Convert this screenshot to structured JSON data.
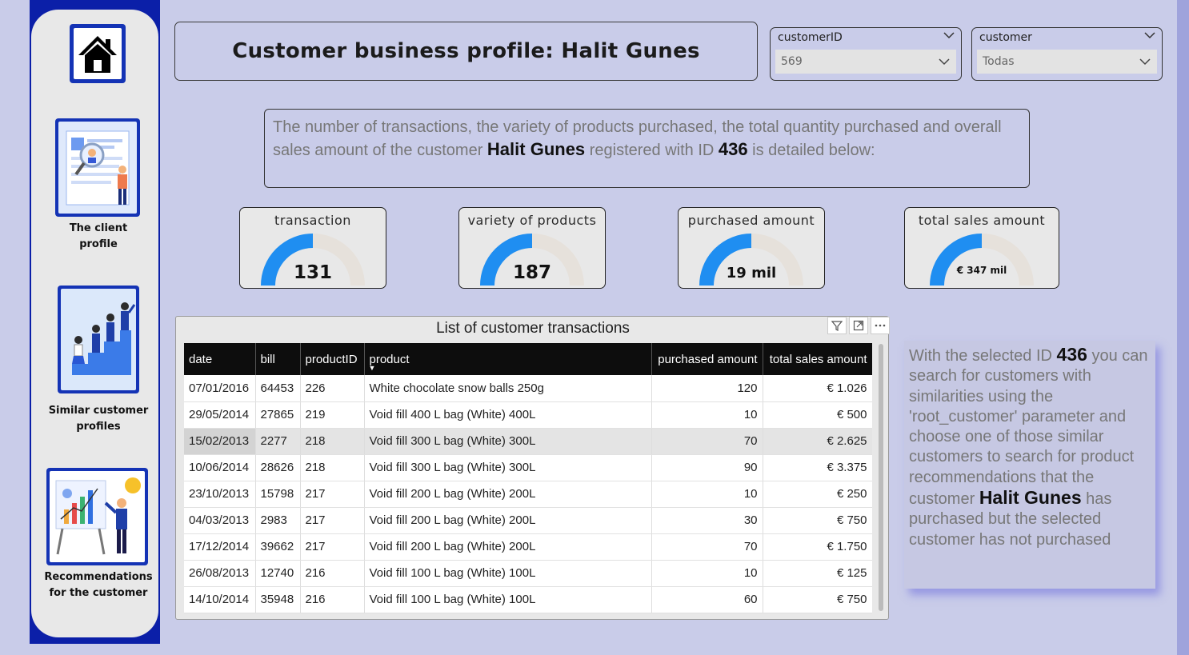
{
  "sidebar": {
    "home": {
      "icon": "home-icon"
    },
    "items": [
      {
        "label": "The client profile",
        "icon": "client-profile-illustration"
      },
      {
        "label": "Similar customer profiles",
        "icon": "similar-customers-illustration"
      },
      {
        "label": "Recommendations for the customer",
        "icon": "recommendations-illustration"
      }
    ]
  },
  "header": {
    "title": "Customer business profile: Halit Gunes"
  },
  "slicers": {
    "customer_id": {
      "label": "customerID",
      "value": "569"
    },
    "customer": {
      "label": "customer",
      "value": "Todas"
    }
  },
  "description": {
    "part1": "The number of transactions, the variety of products purchased, the total quantity purchased and overall sales amount of the customer ",
    "name": "Halit Gunes",
    "part2": " registered with ID ",
    "id": "436",
    "part3": " is detailed below:"
  },
  "kpis": [
    {
      "title": "transaction",
      "value": "131",
      "fill": 0.5
    },
    {
      "title": "variety of products",
      "value": "187",
      "fill": 0.5
    },
    {
      "title": "purchased amount",
      "value": "19 mil",
      "fill": 0.5
    },
    {
      "title": "total sales amount",
      "value": "€ 347 mil",
      "fill": 0.5
    }
  ],
  "table": {
    "title": "List of customer transactions",
    "columns": [
      "date",
      "bill",
      "productID",
      "product",
      "purchased amount",
      "total sales amount"
    ],
    "rows": [
      [
        "07/01/2016",
        "64453",
        "226",
        "White chocolate snow balls 250g",
        "120",
        "€ 1.026"
      ],
      [
        "29/05/2014",
        "27865",
        "219",
        "Void fill 400 L bag (White) 400L",
        "10",
        "€ 500"
      ],
      [
        "15/02/2013",
        "2277",
        "218",
        "Void fill 300 L bag (White) 300L",
        "70",
        "€ 2.625"
      ],
      [
        "10/06/2014",
        "28626",
        "218",
        "Void fill 300 L bag (White) 300L",
        "90",
        "€ 3.375"
      ],
      [
        "23/10/2013",
        "15798",
        "217",
        "Void fill 200 L bag (White) 200L",
        "10",
        "€ 250"
      ],
      [
        "04/03/2013",
        "2983",
        "217",
        "Void fill 200 L bag (White) 200L",
        "30",
        "€ 750"
      ],
      [
        "17/12/2014",
        "39662",
        "217",
        "Void fill 200 L bag (White) 200L",
        "70",
        "€ 1.750"
      ],
      [
        "26/08/2013",
        "12740",
        "216",
        "Void fill 100 L bag (White) 100L",
        "10",
        "€ 125"
      ],
      [
        "14/10/2014",
        "35948",
        "216",
        "Void fill 100 L bag (White) 100L",
        "60",
        "€ 750"
      ]
    ]
  },
  "info": {
    "part1": "With the selected ID ",
    "id": "436",
    "part2": " you can search for customers with similarities using the 'root_customer' parameter and choose one of those similar customers to search for product recommendations that the customer ",
    "name": "Halit Gunes",
    "part3": " has purchased but the selected customer has not purchased"
  },
  "colors": {
    "background": "#c9cce9",
    "sidebar": "#0b1fa8",
    "gauge_fill": "#1f8ef1",
    "gauge_track": "#e6e1db",
    "table_header": "#0d0d0d"
  }
}
